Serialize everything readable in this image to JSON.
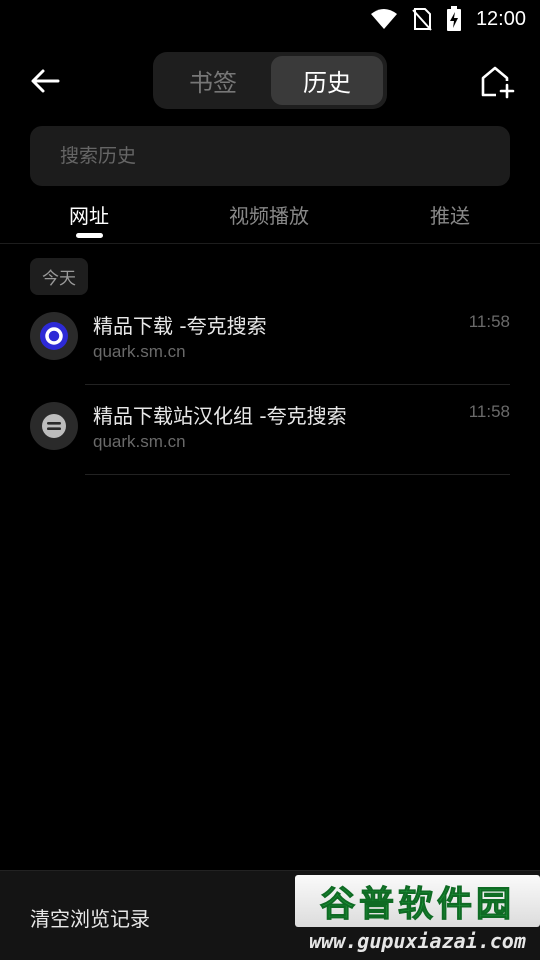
{
  "status_bar": {
    "time": "12:00"
  },
  "header": {
    "segments": [
      {
        "label": "书签",
        "active": false
      },
      {
        "label": "历史",
        "active": true
      }
    ]
  },
  "search": {
    "placeholder": "搜索历史"
  },
  "sub_tabs": [
    {
      "label": "网址",
      "active": true
    },
    {
      "label": "视频播放",
      "active": false
    },
    {
      "label": "推送",
      "active": false
    }
  ],
  "date_group": "今天",
  "history": [
    {
      "title": "精品下载 -夸克搜索",
      "url": "quark.sm.cn",
      "time": "11:58",
      "icon": "quark-icon"
    },
    {
      "title": "精品下载站汉化组 -夸克搜索",
      "url": "quark.sm.cn",
      "time": "11:58",
      "icon": "site-globe-icon"
    }
  ],
  "bottom": {
    "clear_label": "清空浏览记录"
  },
  "watermark": {
    "logo_text": "谷普软件园",
    "url": "www.gupuxiazai.com"
  },
  "colors": {
    "background": "#000000",
    "panel": "#1c1c1c",
    "active_segment": "#3a3a3a",
    "watermark_green": "#1f9a3a"
  }
}
